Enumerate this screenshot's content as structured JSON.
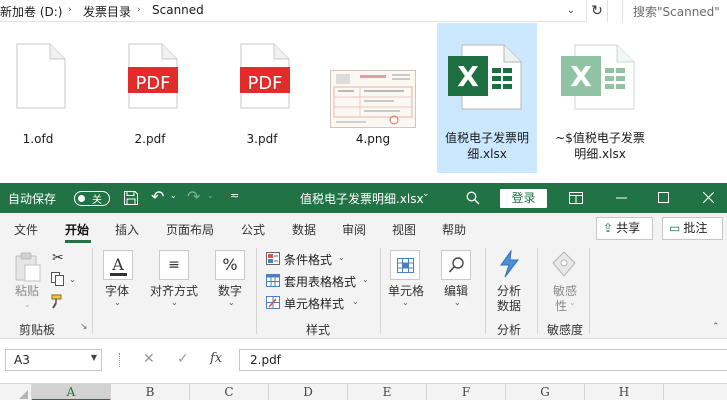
{
  "explorer": {
    "breadcrumbs": [
      "新加卷 (D:)",
      "发票目录",
      "Scanned"
    ],
    "search_placeholder": "搜索\"Scanned\"",
    "files": [
      {
        "name": "1.ofd",
        "icon": "blank-document-icon"
      },
      {
        "name": "2.pdf",
        "icon": "pdf-file-icon",
        "badge": "PDF"
      },
      {
        "name": "3.pdf",
        "icon": "pdf-file-icon",
        "badge": "PDF"
      },
      {
        "name": "4.png",
        "icon": "image-thumbnail-icon"
      },
      {
        "name_line1": "值税电子发票明",
        "name_line2": "细.xlsx",
        "icon": "excel-file-icon",
        "selected": true
      },
      {
        "name_line1": "~$值税电子发票",
        "name_line2": "明细.xlsx",
        "icon": "excel-temp-file-icon"
      }
    ],
    "colors": {
      "pdf_red": "#e32b2b",
      "excel_green": "#1d6f42",
      "selection": "#cce8ff"
    }
  },
  "excel": {
    "autosave_label": "自动保存",
    "autosave_state": "关",
    "doc_title": "值税电子发票明细.xlsx",
    "title_dropdown": "⌄",
    "login_label": "登录",
    "accent": "#217346",
    "tabs": [
      "文件",
      "开始",
      "插入",
      "页面布局",
      "公式",
      "数据",
      "审阅",
      "视图",
      "帮助"
    ],
    "active_tab": "开始",
    "share_label": "共享",
    "comments_label": "批注",
    "ribbon": {
      "clipboard": {
        "paste_label": "粘贴",
        "group_label": "剪贴板"
      },
      "font_label": "字体",
      "align_label": "对齐方式",
      "number_label": "数字",
      "number_symbol": "%",
      "styles": {
        "conditional": "条件格式",
        "table_format": "套用表格格式",
        "cell_styles": "单元格样式",
        "group_label": "样式"
      },
      "cells_label": "单元格",
      "edit_label": "编辑",
      "analysis": {
        "line1": "分析",
        "line2": "数据",
        "group_label": "分析"
      },
      "sensitivity": {
        "line1": "敏感",
        "line2": "性",
        "group_label": "敏感度"
      }
    },
    "formula_bar": {
      "name_box": "A3",
      "formula": "2.pdf",
      "fx": "fx"
    },
    "columns": [
      "A",
      "B",
      "C",
      "D",
      "E",
      "F",
      "G",
      "H"
    ],
    "selected_column": "A"
  }
}
